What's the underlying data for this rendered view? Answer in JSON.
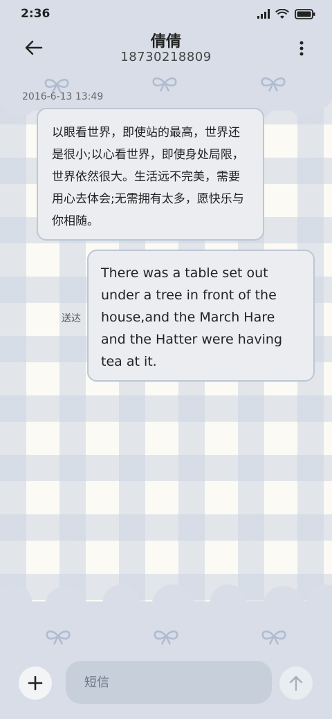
{
  "status_bar": {
    "time": "2:36"
  },
  "header": {
    "contact_name": "倩倩",
    "contact_number": "18730218809"
  },
  "conversation": {
    "timestamp": "2016-6-13 13:49",
    "messages": [
      {
        "direction": "incoming",
        "text": "以眼看世界，即使站的最高，世界还是很小;以心看世界，即使身处局限，世界依然很大。生活远不完美，需要用心去体会;无需拥有太多，愿快乐与你相随。"
      },
      {
        "direction": "outgoing",
        "text": "There was a table set out under a tree in front of the house,and the March Hare and the Hatter were having tea at it.",
        "status": "送达"
      }
    ]
  },
  "composer": {
    "placeholder": "短信"
  },
  "icons": {
    "back": "back-arrow-icon",
    "more": "more-vertical-icon",
    "add": "plus-icon",
    "send": "send-arrow-up-icon",
    "signal": "signal-icon",
    "wifi": "wifi-icon",
    "battery": "battery-icon"
  },
  "colors": {
    "bubble_bg": "#ebedf0",
    "bubble_border": "#bcc6d6",
    "theme_blue_gray": "#d8dde7"
  }
}
